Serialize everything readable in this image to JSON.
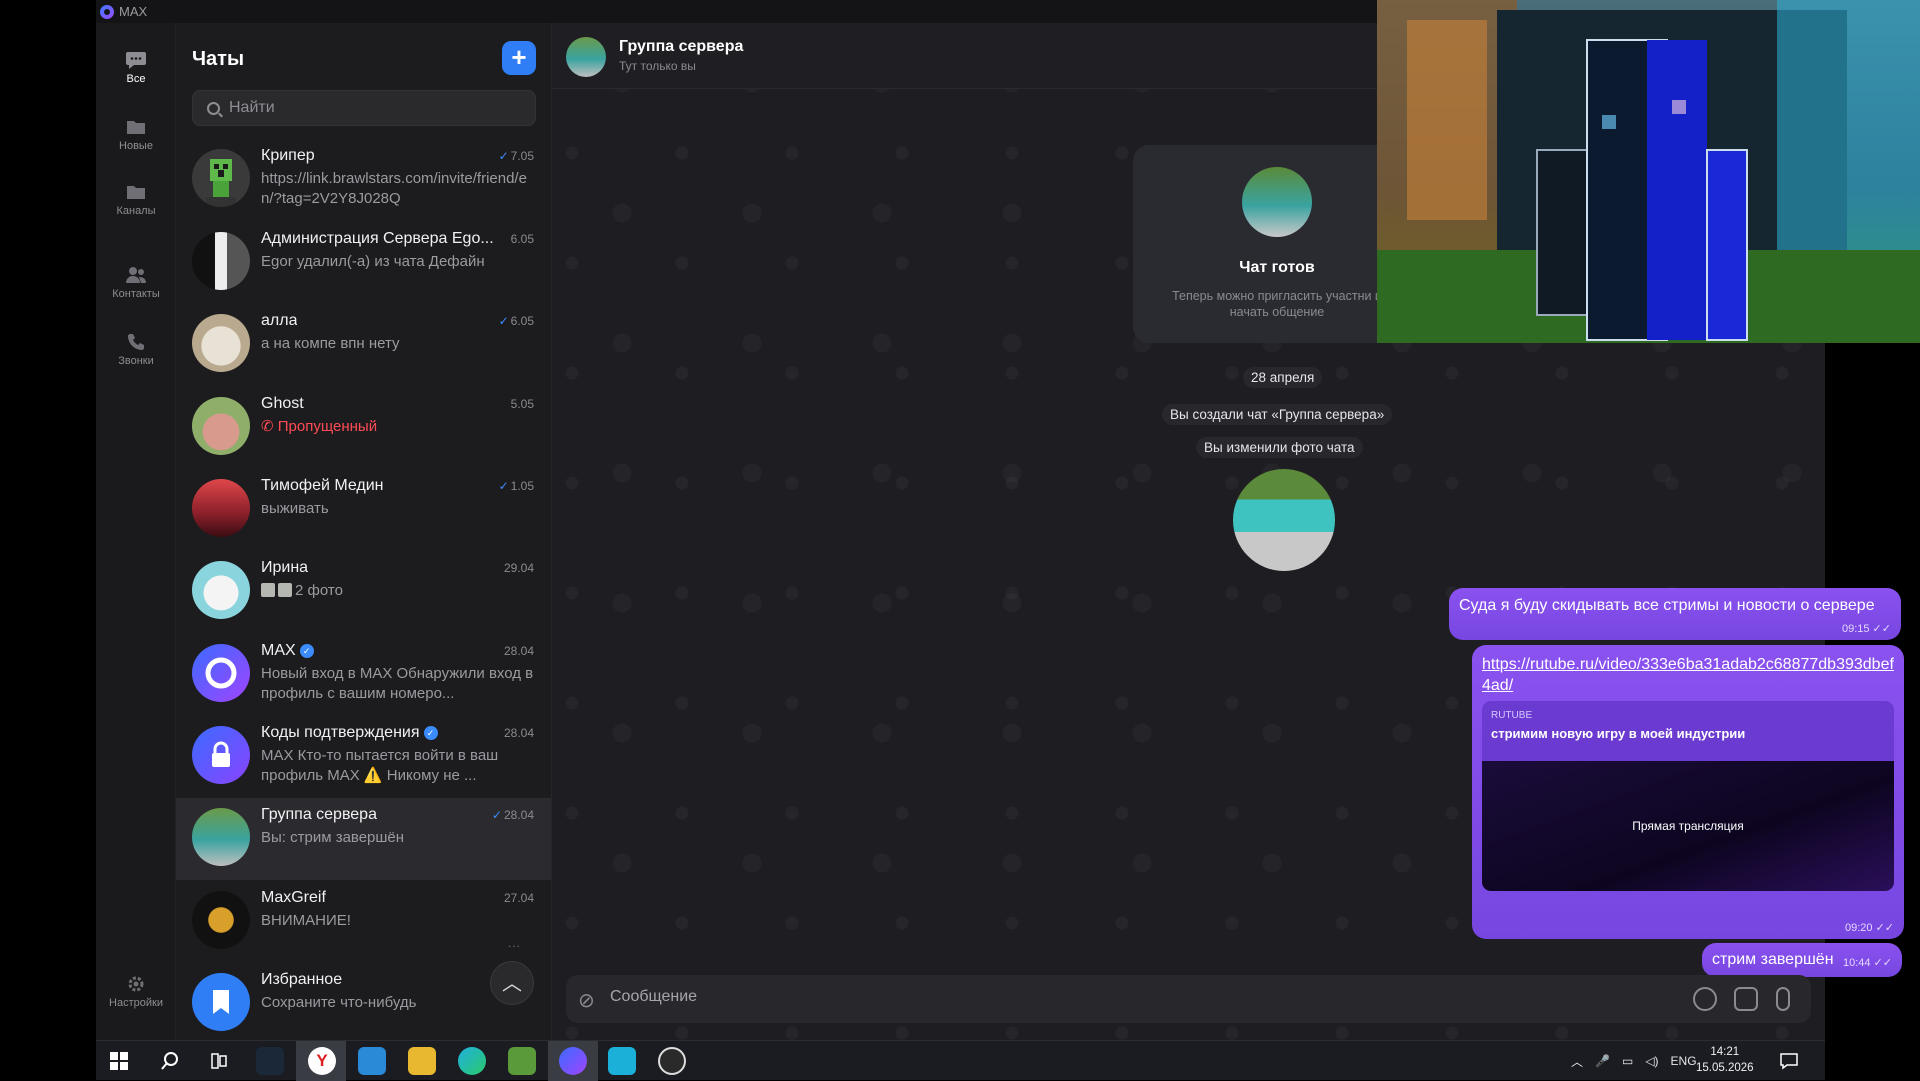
{
  "app": {
    "title": "MAX"
  },
  "rail": {
    "items": [
      {
        "label": "Все",
        "icon": "chat-bubble-icon"
      },
      {
        "label": "Новые",
        "icon": "folder-icon"
      },
      {
        "label": "Каналы",
        "icon": "folder-icon"
      },
      {
        "label": "Контакты",
        "icon": "contacts-icon"
      },
      {
        "label": "Звонки",
        "icon": "phone-icon"
      }
    ],
    "settings_label": "Настройки"
  },
  "chatlist": {
    "title": "Чаты",
    "add_label": "+",
    "search_placeholder": "Найти",
    "chats": [
      {
        "name": "Крипер",
        "time": "7.05",
        "read": true,
        "preview": "https://link.brawlstars.com/invite/friend/en/?tag=2V2Y8J028Q"
      },
      {
        "name": "Администрация Сервера Ego...",
        "time": "6.05",
        "read": false,
        "preview": "Egor удалил(-а) из чата Дефайн"
      },
      {
        "name": "алла",
        "time": "6.05",
        "read": true,
        "preview": "а на компе впн нету"
      },
      {
        "name": "Ghost",
        "time": "5.05",
        "read": false,
        "preview": "Пропущенный",
        "missed": true
      },
      {
        "name": "Тимофей Медин",
        "time": "1.05",
        "read": true,
        "preview": "выживать"
      },
      {
        "name": "Ирина",
        "time": "29.04",
        "read": false,
        "preview": "2 фото"
      },
      {
        "name": "MAX",
        "time": "28.04",
        "read": false,
        "verified": true,
        "preview": "Новый вход в MAX Обнаружили вход в профиль с вашим номеро..."
      },
      {
        "name": "Коды подтверждения",
        "time": "28.04",
        "read": false,
        "verified": true,
        "preview": "MAX Кто-то пытается войти в ваш профиль MAX ⚠️ Никому не ..."
      },
      {
        "name": "Группа сервера",
        "time": "28.04",
        "read": true,
        "preview": "Вы: стрим завершён",
        "selected": true
      },
      {
        "name": "MaxGreif",
        "time": "27.04",
        "read": false,
        "preview": "ВНИМАНИЕ!"
      },
      {
        "name": "Избранное",
        "time": "",
        "read": false,
        "preview": "Сохраните что-нибудь"
      }
    ]
  },
  "conversation": {
    "title": "Группа сервера",
    "subtitle": "Тут только вы",
    "created_card": {
      "title": "Чат готов",
      "subtitle": "Теперь можно пригласить участни и начать общение"
    },
    "date_pill": "28 апреля",
    "system_created": "Вы создали чат «Группа сервера»",
    "system_photo": "Вы изменили фото чата",
    "messages": [
      {
        "text": "Суда я буду скидывать все стримы и новости о сервере",
        "time": "09:15"
      },
      {
        "link": "https://rutube.ru/video/333e6ba31adab2c68877db393dbef4ad/",
        "preview_source": "RUTUBE",
        "preview_title": "стримим новую игру в моей индустрии",
        "preview_caption": "Прямая трансляция",
        "time": "09:20"
      },
      {
        "text": "стрим завершён",
        "time": "10:44"
      }
    ],
    "composer_placeholder": "Сообщение"
  },
  "taskbar": {
    "lang": "ENG",
    "time": "14:21",
    "date": "15.05.2026"
  },
  "colors": {
    "accent": "#2f7ef5",
    "bubble": "#8a52f0",
    "missed": "#ff4b55"
  }
}
